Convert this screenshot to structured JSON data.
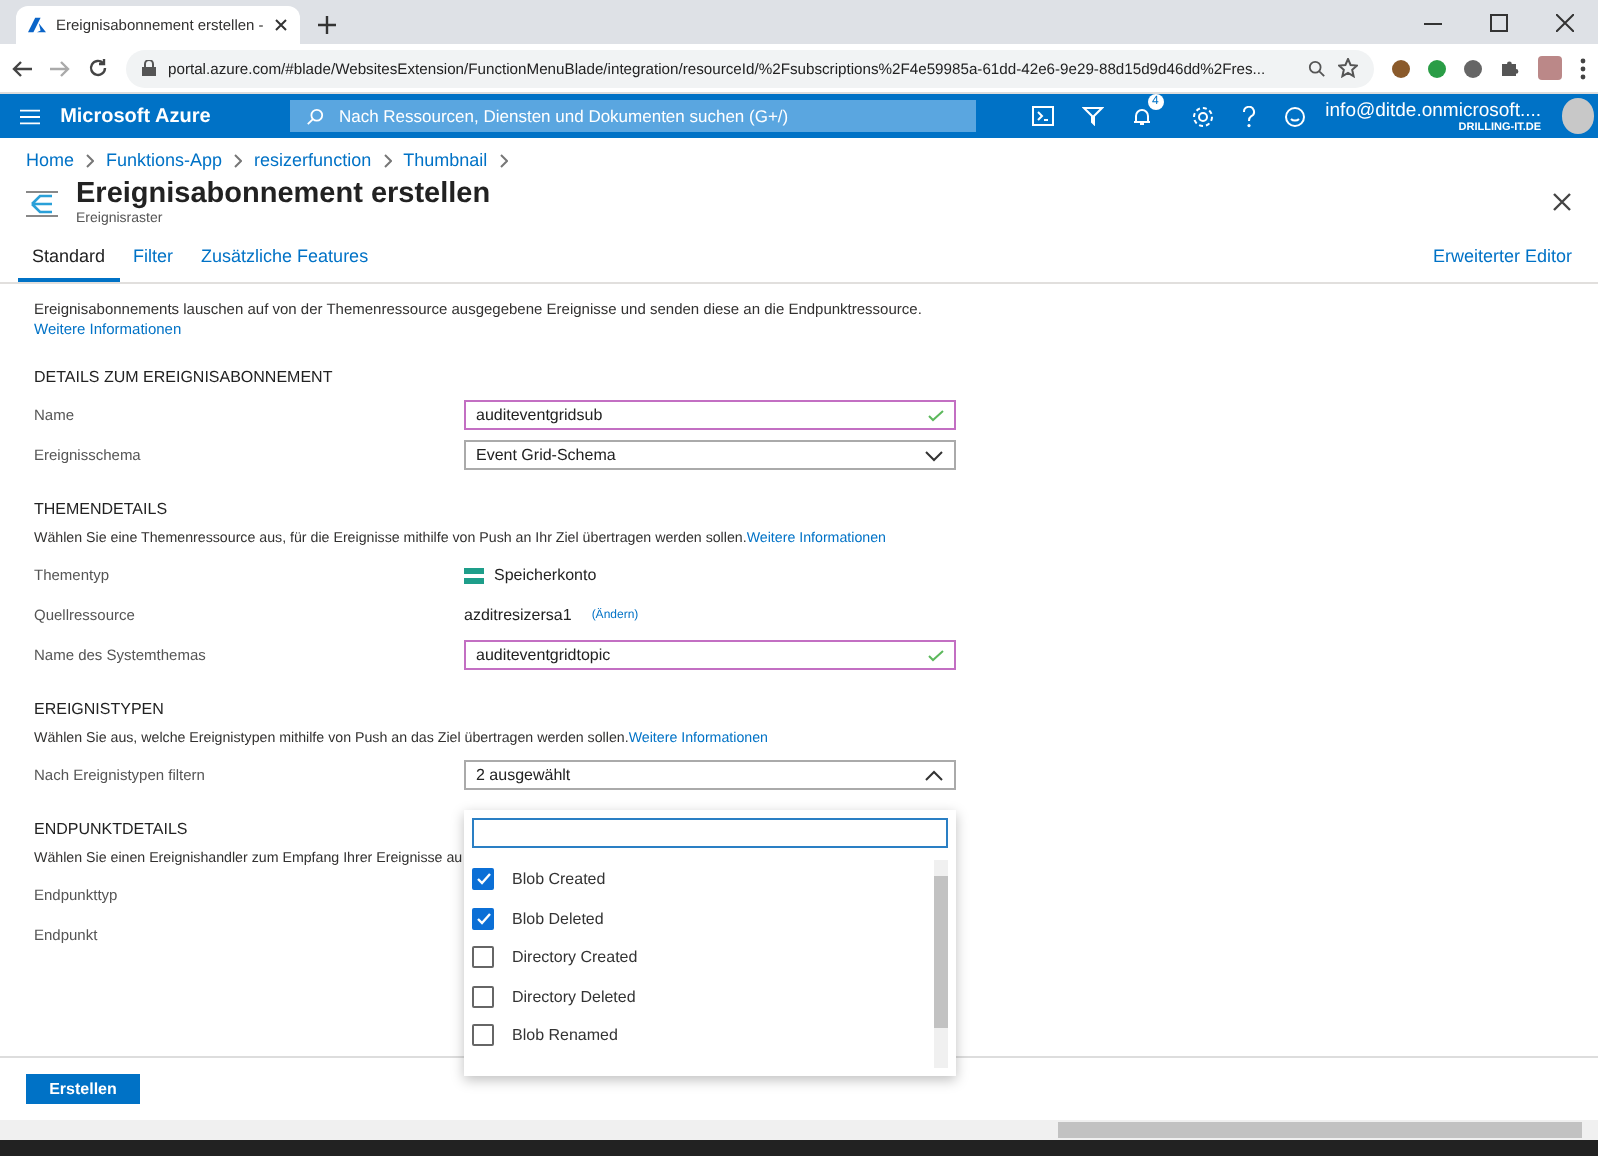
{
  "browser": {
    "tab_title": "Ereignisabonnement erstellen - ",
    "url": "portal.azure.com/#blade/WebsitesExtension/FunctionMenuBlade/integration/resourceId/%2Fsubscriptions%2F4e59985a-61dd-42e6-9e29-88d15d9d46dd%2Fres..."
  },
  "portal": {
    "brand": "Microsoft Azure",
    "search_placeholder": "Nach Ressourcen, Diensten und Dokumenten suchen (G+/)",
    "notification_count": "4",
    "user_email": "info@ditde.onmicrosoft....",
    "user_org": "DRILLING-IT.DE"
  },
  "breadcrumb": [
    "Home",
    "Funktions-App",
    "resizerfunction",
    "Thumbnail"
  ],
  "blade": {
    "title": "Ereignisabonnement erstellen",
    "subtitle": "Ereignisraster"
  },
  "tabs": [
    {
      "label": "Standard",
      "selected": true
    },
    {
      "label": "Filter",
      "selected": false
    },
    {
      "label": "Zusätzliche Features",
      "selected": false
    }
  ],
  "advanced_editor": "Erweiterter Editor",
  "intro": {
    "text": "Ereignisabonnements lauschen auf von der Themenressource ausgegebene Ereignisse und senden diese an die Endpunktressource.",
    "link": "Weitere Informationen"
  },
  "sections": [
    {
      "heading": "DETAILS ZUM EREIGNISABONNEMENT",
      "fields": [
        {
          "kind": "input",
          "label": "Name",
          "value": "auditeventgridsub",
          "valid": true
        },
        {
          "kind": "select",
          "label": "Ereignisschema",
          "value": "Event Grid-Schema",
          "expanded": false
        }
      ]
    },
    {
      "heading": "THEMENDETAILS",
      "description": "Wählen Sie eine Themenressource aus, für die Ereignisse mithilfe von Push an Ihr Ziel übertragen werden sollen.",
      "link": "Weitere Informationen",
      "fields": [
        {
          "kind": "storage",
          "label": "Thementyp",
          "value": "Speicherkonto"
        },
        {
          "kind": "change",
          "label": "Quellressource",
          "value": "azditresizersa1",
          "action": "(Ändern)"
        },
        {
          "kind": "input",
          "label": "Name des Systemthemas",
          "value": "auditeventgridtopic",
          "valid": true
        }
      ]
    },
    {
      "heading": "EREIGNISTYPEN",
      "description": "Wählen Sie aus, welche Ereignistypen mithilfe von Push an das Ziel übertragen werden sollen.",
      "link": "Weitere Informationen",
      "fields": [
        {
          "kind": "select",
          "label": "Nach Ereignistypen filtern",
          "value": "2 ausgewählt",
          "expanded": true
        }
      ]
    },
    {
      "heading": "ENDPUNKTDETAILS",
      "description": "Wählen Sie einen Ereignishandler zum Empfang Ihrer Ereignisse au",
      "fields": [
        {
          "kind": "endpoint",
          "label": "Endpunkttyp"
        },
        {
          "kind": "text",
          "label": "Endpunkt"
        }
      ]
    }
  ],
  "event_types": [
    {
      "label": "Blob Created",
      "checked": true
    },
    {
      "label": "Blob Deleted",
      "checked": true
    },
    {
      "label": "Directory Created",
      "checked": false
    },
    {
      "label": "Directory Deleted",
      "checked": false
    },
    {
      "label": "Blob Renamed",
      "checked": false
    }
  ],
  "create_button": "Erstellen"
}
